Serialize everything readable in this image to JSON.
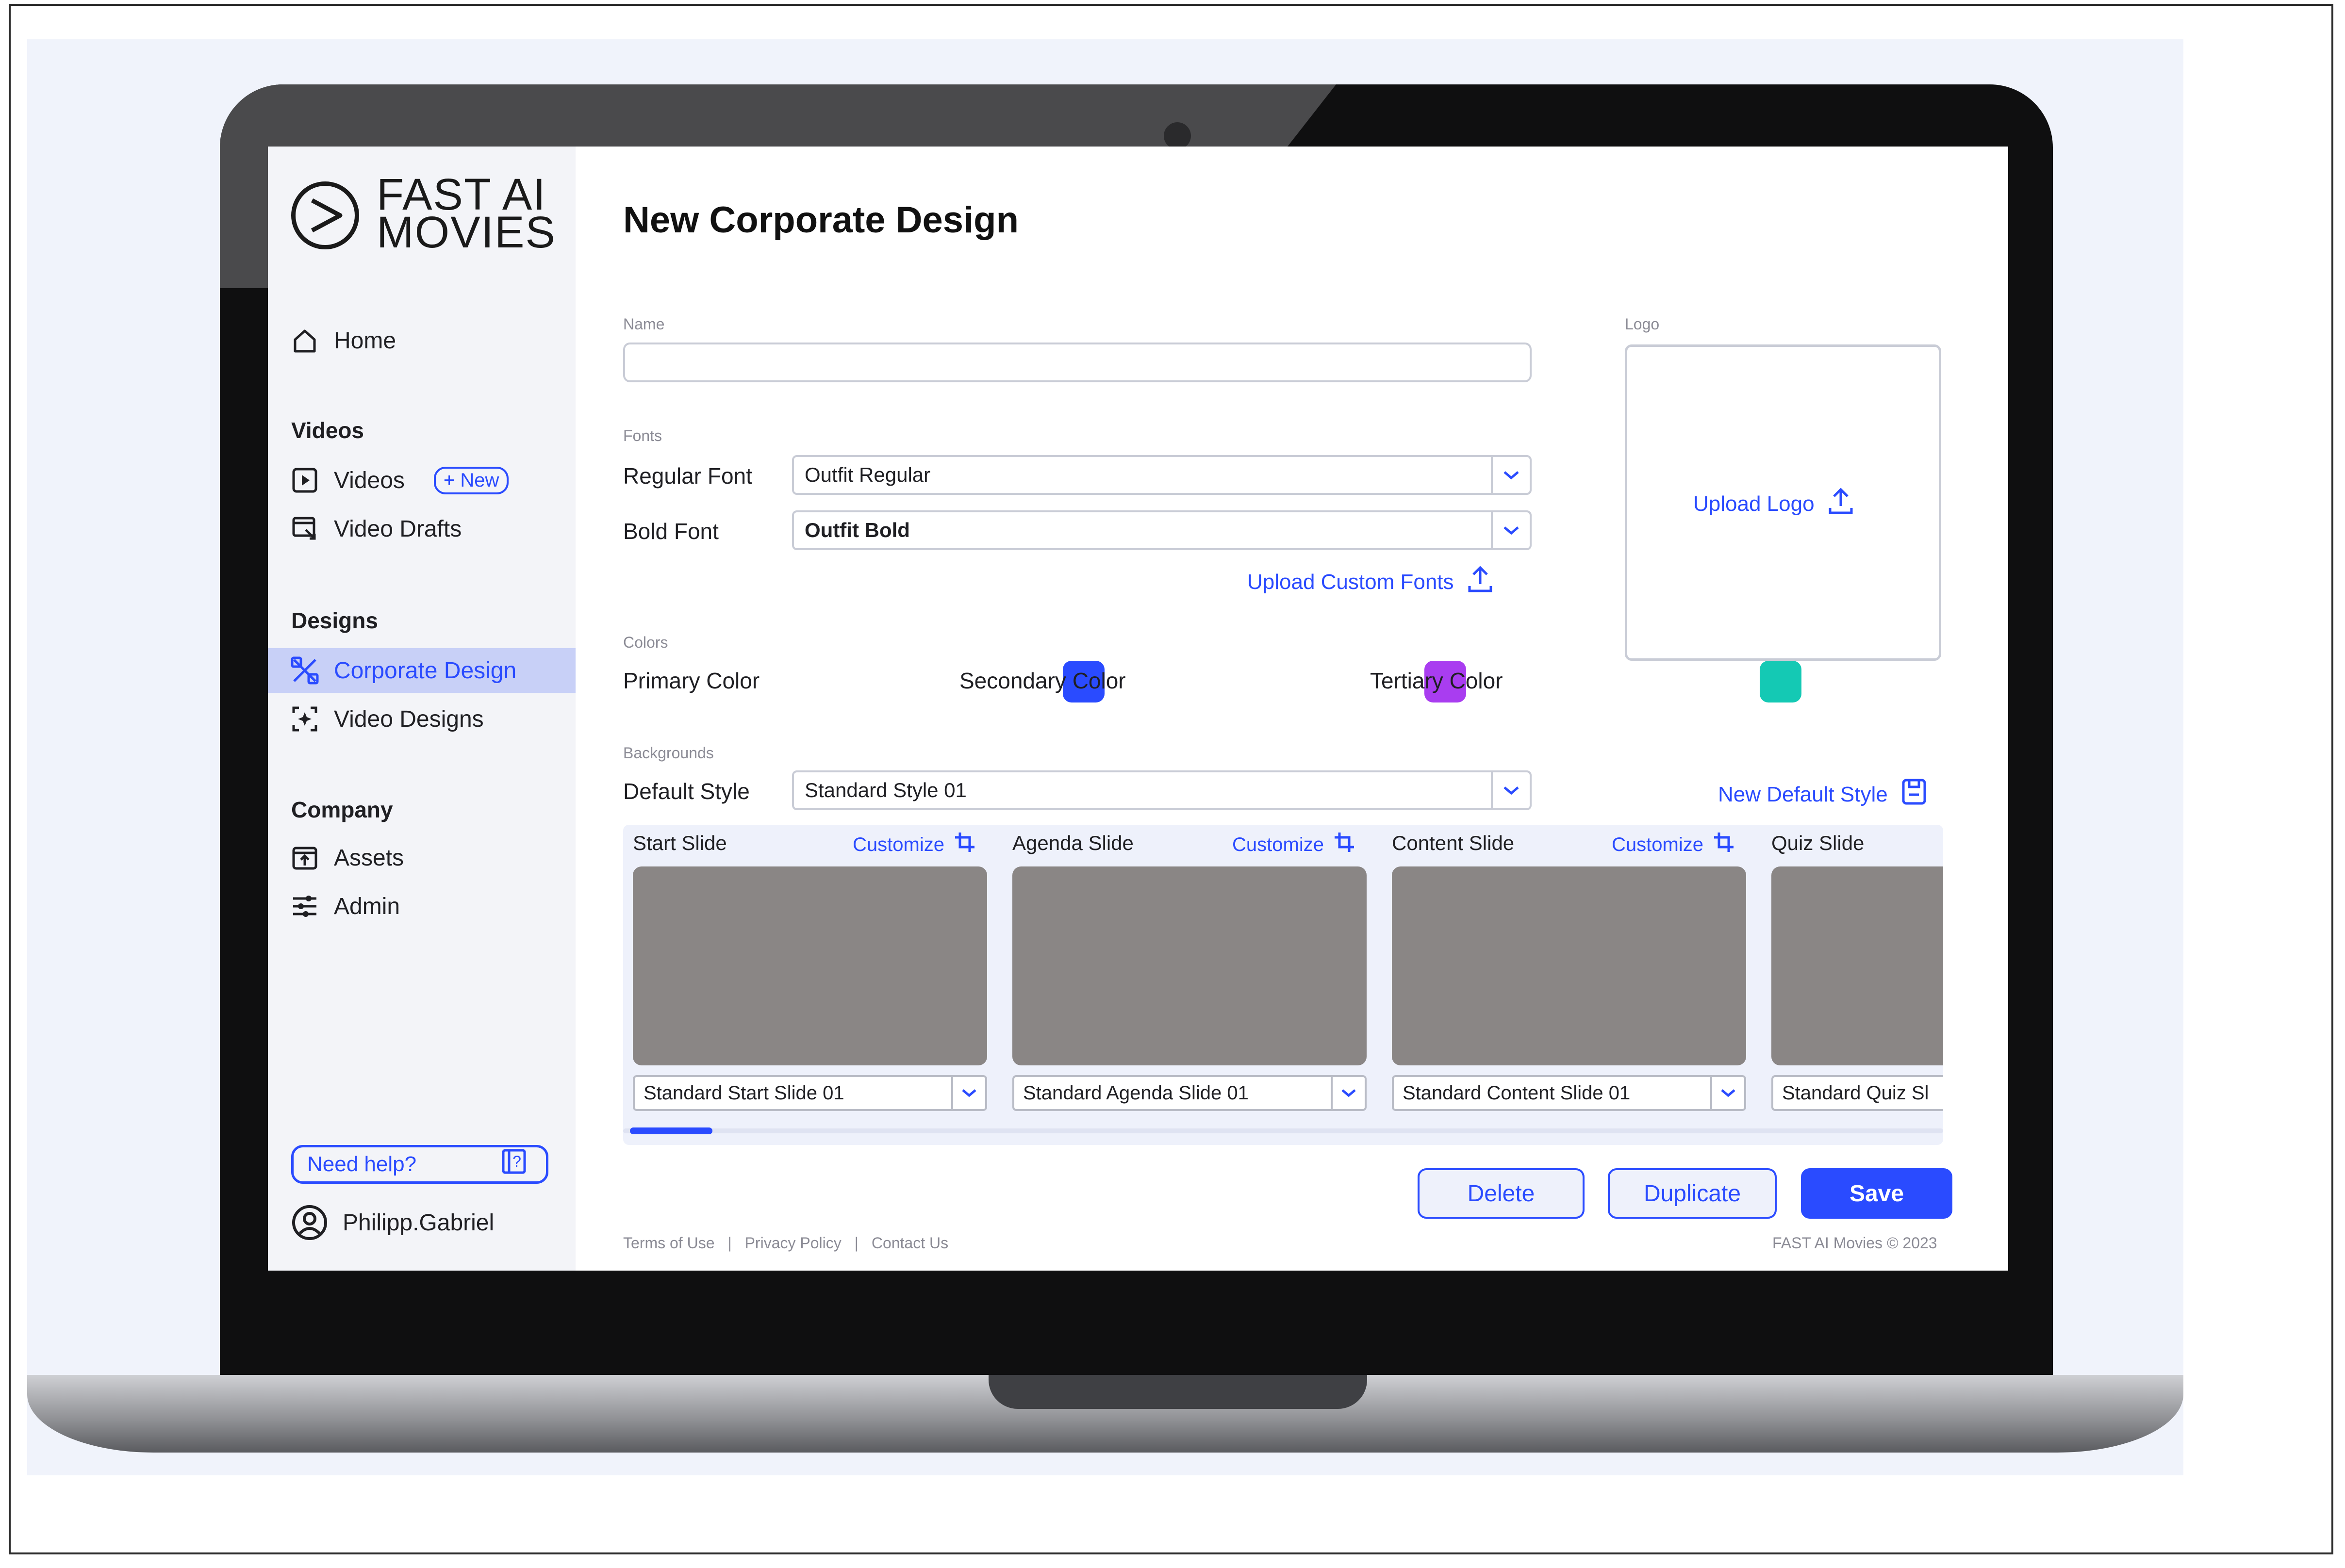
{
  "brand": {
    "line1": "FAST AI",
    "line2": "MOVIES"
  },
  "sidebar": {
    "home": "Home",
    "sections": {
      "videos": "Videos",
      "designs": "Designs",
      "company": "Company"
    },
    "items": [
      {
        "label": "Videos",
        "badge": "+ New"
      },
      {
        "label": "Video Drafts"
      },
      {
        "label": "Corporate Design"
      },
      {
        "label": "Video Designs"
      },
      {
        "label": "Assets"
      },
      {
        "label": "Admin"
      }
    ],
    "help": "Need help?",
    "user": "Philipp.Gabriel"
  },
  "page": {
    "title": "New Corporate Design",
    "name_label": "Name",
    "name_value": "",
    "logo_label": "Logo",
    "upload_logo": "Upload Logo",
    "fonts_label": "Fonts",
    "regular_font_label": "Regular Font",
    "regular_font_value": "Outfit Regular",
    "bold_font_label": "Bold Font",
    "bold_font_value": "Outfit Bold",
    "upload_fonts": "Upload Custom Fonts",
    "colors_label": "Colors",
    "colors": [
      {
        "label": "Primary Color",
        "hex": "#2a4bff"
      },
      {
        "label": "Secondary Color",
        "hex": "#a93df0"
      },
      {
        "label": "Tertiary Color",
        "hex": "#14c9b4"
      }
    ],
    "backgrounds_label": "Backgrounds",
    "default_style_label": "Default Style",
    "default_style_value": "Standard Style 01",
    "new_default_style": "New Default Style",
    "slides": [
      {
        "name": "Start Slide",
        "customize": "Customize",
        "value": "Standard Start Slide 01"
      },
      {
        "name": "Agenda Slide",
        "customize": "Customize",
        "value": "Standard Agenda Slide 01"
      },
      {
        "name": "Content Slide",
        "customize": "Customize",
        "value": "Standard Content Slide 01"
      },
      {
        "name": "Quiz Slide",
        "value": "Standard Quiz Sl"
      }
    ],
    "buttons": {
      "delete": "Delete",
      "duplicate": "Duplicate",
      "save": "Save"
    },
    "footer": {
      "terms": "Terms of Use",
      "privacy": "Privacy Policy",
      "contact": "Contact Us",
      "sep": "|",
      "copyright": "FAST AI Movies © 2023"
    }
  }
}
